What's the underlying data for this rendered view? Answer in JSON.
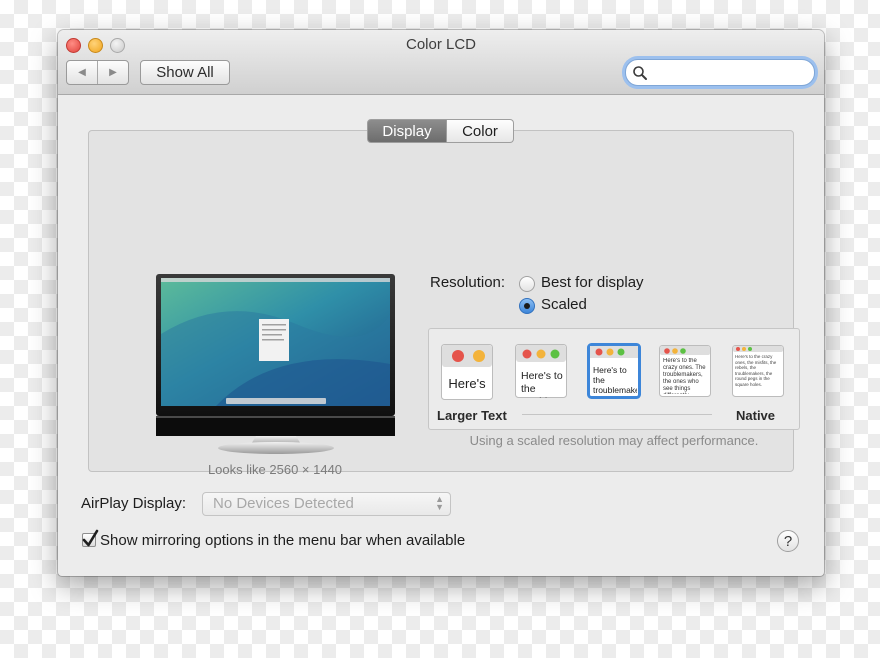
{
  "window": {
    "title": "Color LCD"
  },
  "toolbar": {
    "back_icon": "back-arrow-icon",
    "forward_icon": "forward-arrow-icon",
    "show_all_label": "Show All",
    "search_value": "",
    "search_icon": "magnifier-icon"
  },
  "tabs": [
    {
      "label": "Display",
      "selected": true
    },
    {
      "label": "Color",
      "selected": false
    }
  ],
  "display": {
    "looks_like": "Looks like 2560 × 1440",
    "resolution_label": "Resolution:",
    "resolution_options": [
      {
        "label": "Best for display",
        "selected": false
      },
      {
        "label": "Scaled",
        "selected": true
      }
    ],
    "scale_options": [
      {
        "text": "Here's",
        "selected": false
      },
      {
        "text": "Here's to the troublemakers.",
        "selected": false
      },
      {
        "text": "Here's to the troublemakers.",
        "selected": true
      },
      {
        "text": "Here's to the crazy ones. The troublemakers, the ones who see things differently.",
        "selected": false
      },
      {
        "text": "Here's to the crazy ones, the misfits, the rebels, the troublemakers, the round pegs in the square holes.",
        "selected": false
      }
    ],
    "larger_text_label": "Larger Text",
    "native_label": "Native",
    "performance_note": "Using a scaled resolution may affect performance."
  },
  "airplay": {
    "label": "AirPlay Display:",
    "value": "No Devices Detected"
  },
  "mirroring": {
    "label": "Show mirroring options in the menu bar when available",
    "checked": true
  },
  "help_label": "?",
  "colors": {
    "accent": "#3d86d9",
    "selected_tab": "#7d7d7d",
    "close": "#e0443e",
    "minimize": "#f0a51e"
  }
}
